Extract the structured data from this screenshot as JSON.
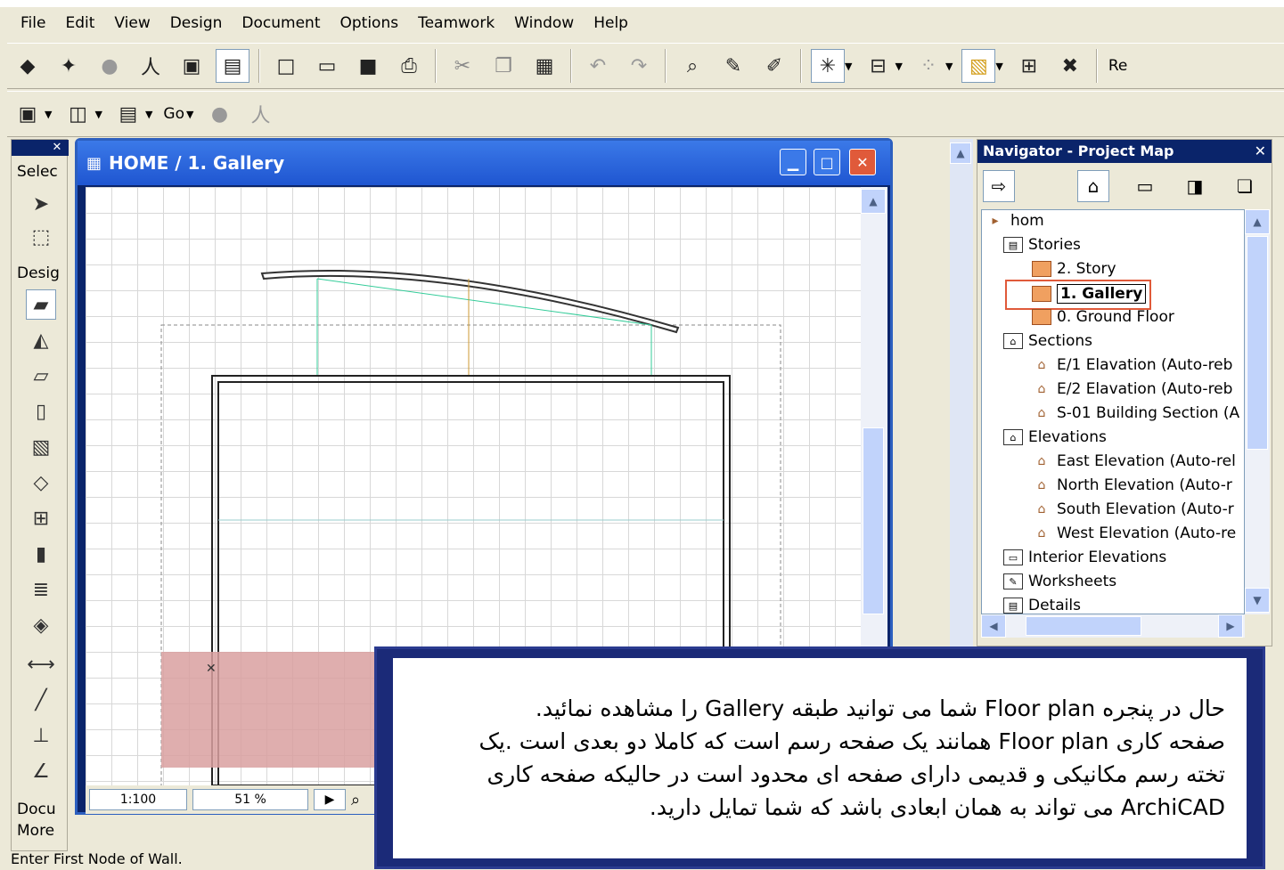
{
  "menu": [
    "File",
    "Edit",
    "View",
    "Design",
    "Document",
    "Options",
    "Teamwork",
    "Window",
    "Help"
  ],
  "toolbar2": {
    "go_label": "Go"
  },
  "toolbar1": {
    "overflow_label": "Re"
  },
  "toolbox": {
    "select_label": "Selec",
    "design_label": "Desig",
    "document_label": "Docu",
    "more_label": "More"
  },
  "plan_window": {
    "title": "HOME / 1. Gallery",
    "scale": "1:100",
    "zoom": "51 %"
  },
  "navigator": {
    "title": "Navigator - Project Map",
    "root": "hom",
    "stories_label": "Stories",
    "stories": [
      "2. Story",
      "1. Gallery",
      "0. Ground Floor"
    ],
    "sections_label": "Sections",
    "sections": [
      "E/1 Elavation (Auto-reb",
      "E/2 Elavation (Auto-reb",
      "S-01 Building Section (A"
    ],
    "elevations_label": "Elevations",
    "elevations": [
      "East Elevation (Auto-rel",
      "North Elevation (Auto-r",
      "South Elevation (Auto-r",
      "West Elevation (Auto-re"
    ],
    "others": [
      "Interior Elevations",
      "Worksheets",
      "Details"
    ]
  },
  "note": {
    "line1": "حال در پنجره Floor plan شما می توانید طبقه Gallery را مشاهده نمائید.",
    "line2": "صفحه کاری Floor plan همانند یک صفحه رسم است که کاملا دو بعدی است .یک",
    "line3": "تخته رسم مکانیکی و قدیمی دارای صفحه ای محدود است در حالیکه صفحه کاری",
    "line4": "ArchiCAD می تواند به همان ابعادی باشد که شما تمایل دارید."
  },
  "status": {
    "text": "Enter First Node of Wall."
  },
  "colors": {
    "title_blue": "#1f56d1",
    "nav_title": "#0a246a",
    "highlight": "#e05a3a"
  }
}
